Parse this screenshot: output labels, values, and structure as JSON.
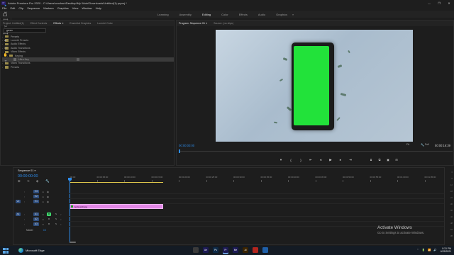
{
  "window": {
    "title": "Adobe Premiere Pro 2020 - C:\\Users\\cruchan\\Desktop\\My Work\\Downloads\\Untitled(1).prproj *",
    "controls": [
      "—",
      "❐",
      "✕"
    ]
  },
  "menu": [
    "File",
    "Edit",
    "Clip",
    "Sequence",
    "Markers",
    "Graphics",
    "View",
    "Window",
    "Help"
  ],
  "workspaces": {
    "tabs": [
      "Learning",
      "Assembly",
      "Editing",
      "Color",
      "Effects",
      "Audio",
      "Graphics"
    ],
    "active": "Editing",
    "more": "»"
  },
  "effects_panel": {
    "tabs": [
      "Project: Untitled(1)",
      "Effect Controls",
      "Effects ≡",
      "Essential Graphics",
      "Lumetri Color"
    ],
    "search_value": "green",
    "tree": [
      {
        "label": "Presets",
        "depth": 0,
        "caret": "›",
        "folder": true
      },
      {
        "label": "Lumetri Presets",
        "depth": 0,
        "caret": "›",
        "folder": true
      },
      {
        "label": "Audio Effects",
        "depth": 0,
        "caret": "›",
        "folder": true
      },
      {
        "label": "Audio Transitions",
        "depth": 0,
        "caret": "›",
        "folder": true
      },
      {
        "label": "Video Effects",
        "depth": 0,
        "caret": "⌄",
        "folder": true
      },
      {
        "label": "Keying",
        "depth": 1,
        "caret": "⌄",
        "folder": true
      },
      {
        "label": "Ultra Key",
        "depth": 2,
        "caret": "",
        "folder": false,
        "selected": true
      },
      {
        "label": "Video Transitions",
        "depth": 0,
        "caret": "›",
        "folder": true
      },
      {
        "label": "Presets",
        "depth": 0,
        "caret": "›",
        "folder": true
      }
    ]
  },
  "program_monitor": {
    "tabs": [
      "Program: Sequence 01 ≡",
      "Source: (no clips)"
    ],
    "timecode_current": "00:00:00:00",
    "timecode_duration": "00:00:16:39",
    "fit": "Fit",
    "full": "Full",
    "transport_icons": [
      "marker-icon",
      "in-point-icon",
      "out-point-icon",
      "go-to-in-icon",
      "step-back-icon",
      "play-icon",
      "step-forward-icon",
      "go-to-out-icon",
      "insert-icon",
      "overwrite-icon",
      "export-frame-icon",
      "button-editor-icon"
    ],
    "transport_glyphs": [
      "▾",
      "{",
      "}",
      "⇤",
      "◂",
      "▶",
      "▸",
      "⇥"
    ],
    "transport_right_glyphs": [
      "⧈",
      "⧉",
      "▣",
      "⊞"
    ],
    "screen_color": "#22e23a"
  },
  "tools": [
    "▸",
    "⇿",
    "⟺",
    "✂",
    "⟷",
    "✒",
    "▭",
    "✋",
    "T"
  ],
  "timeline": {
    "tab": "Sequence 01 ≡",
    "timecode": "00:00:00:00",
    "ruler": [
      ":00:00",
      "00:00:05:00",
      "00:00:10:00",
      "00:00:15:00",
      "00:00:20:00",
      "00:00:25:00",
      "00:00:30:00",
      "00:00:35:00",
      "00:00:40:00",
      "00:00:45:00",
      "00:00:50:00",
      "00:00:55:00",
      "00:01:00:00",
      "00:01:05:00"
    ],
    "tool_glyphs": [
      "⊕",
      "⊃",
      "⬖",
      "🔧"
    ],
    "video_tracks": [
      {
        "name": "V3",
        "target": "",
        "lock": "🔒",
        "sync": "▭",
        "eye": "👁"
      },
      {
        "name": "V2",
        "target": "",
        "lock": "🔒",
        "sync": "▭",
        "eye": "👁"
      },
      {
        "name": "V1",
        "target": "V1",
        "lock": "🔒",
        "sync": "▭",
        "eye": "👁"
      }
    ],
    "audio_tracks": [
      {
        "name": "A1",
        "target": "A1",
        "m": "M",
        "s": "S",
        "mic": "🎙"
      },
      {
        "name": "A2",
        "target": "",
        "m": "M",
        "s": "S",
        "mic": "🎙"
      },
      {
        "name": "A3",
        "target": "",
        "m": "M",
        "s": "S",
        "mic": "🎙"
      }
    ],
    "master": {
      "label": "Master",
      "value": "0.0"
    },
    "clip_label": "mockup(1).jpg",
    "clip_color": "#e287e6"
  },
  "vu_meter": {
    "labels": [
      "0",
      "-6",
      "-12",
      "-18",
      "-24",
      "-30",
      "-36",
      "-42",
      "-48",
      "-54",
      "dB"
    ]
  },
  "watermark": {
    "heading": "Activate Windows",
    "sub": "Go to Settings to activate Windows."
  },
  "taskbar": {
    "app_label": "Microsoft Edge",
    "apps": [
      {
        "label": "",
        "color": "#3a3a3a",
        "name": "file-explorer-icon"
      },
      {
        "label": "Ae",
        "color": "#1c1a55",
        "name": "after-effects-icon"
      },
      {
        "label": "Ps",
        "color": "#0e2a48",
        "name": "photoshop-icon"
      },
      {
        "label": "Pr",
        "color": "#1c1a55",
        "name": "premiere-icon",
        "active": true
      },
      {
        "label": "Me",
        "color": "#1c1a55",
        "name": "media-encoder-icon"
      },
      {
        "label": "Ai",
        "color": "#3a2300",
        "name": "illustrator-icon"
      },
      {
        "label": "",
        "color": "#b3261e",
        "name": "app-red-icon"
      },
      {
        "label": "",
        "color": "#1f5fa8",
        "name": "app-blue-icon"
      }
    ],
    "tray": [
      "⌃",
      "🔋",
      "📶",
      "🔊"
    ],
    "time": "8:31 PM",
    "date": "6/25/2021"
  }
}
